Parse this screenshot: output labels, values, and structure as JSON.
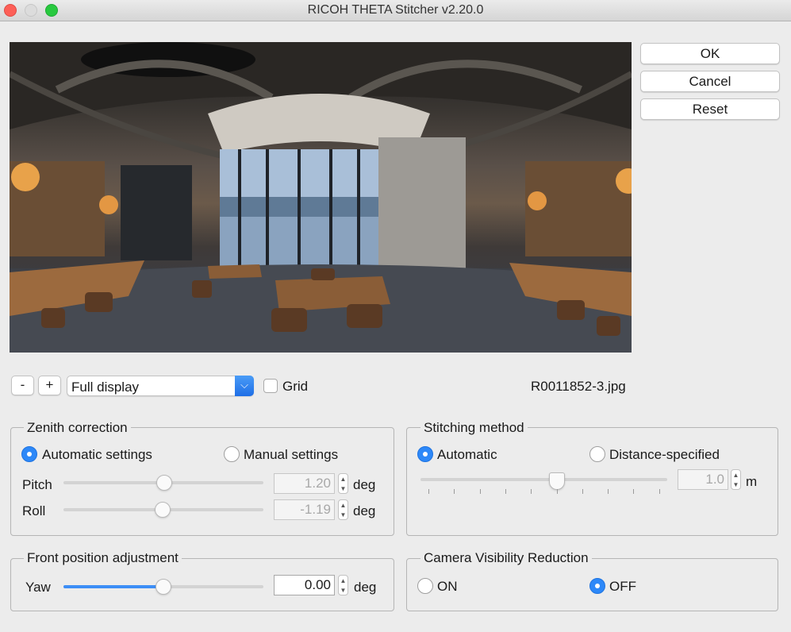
{
  "window": {
    "title": "RICOH THETA Stitcher v2.20.0"
  },
  "actions": {
    "ok": "OK",
    "cancel": "Cancel",
    "reset": "Reset"
  },
  "toolbar": {
    "zoom_out": "-",
    "zoom_in": "+",
    "display_mode": "Full display",
    "grid_label": "Grid",
    "grid_checked": false,
    "filename": "R0011852-3.jpg"
  },
  "zenith": {
    "title": "Zenith correction",
    "automatic_label": "Automatic settings",
    "manual_label": "Manual settings",
    "selected": "automatic",
    "pitch_label": "Pitch",
    "pitch_value": "1.20",
    "pitch_unit": "deg",
    "roll_label": "Roll",
    "roll_value": "-1.19",
    "roll_unit": "deg"
  },
  "stitching": {
    "title": "Stitching method",
    "automatic_label": "Automatic",
    "distance_label": "Distance-specified",
    "selected": "automatic",
    "distance_value": "1.0",
    "distance_unit": "m"
  },
  "front": {
    "title": "Front position adjustment",
    "yaw_label": "Yaw",
    "yaw_value": "0.00",
    "yaw_unit": "deg"
  },
  "camera_visibility": {
    "title": "Camera Visibility Reduction",
    "on_label": "ON",
    "off_label": "OFF",
    "selected": "off"
  },
  "colors": {
    "accent": "#2d88f8",
    "slider_fill": "#3d8ef6"
  }
}
